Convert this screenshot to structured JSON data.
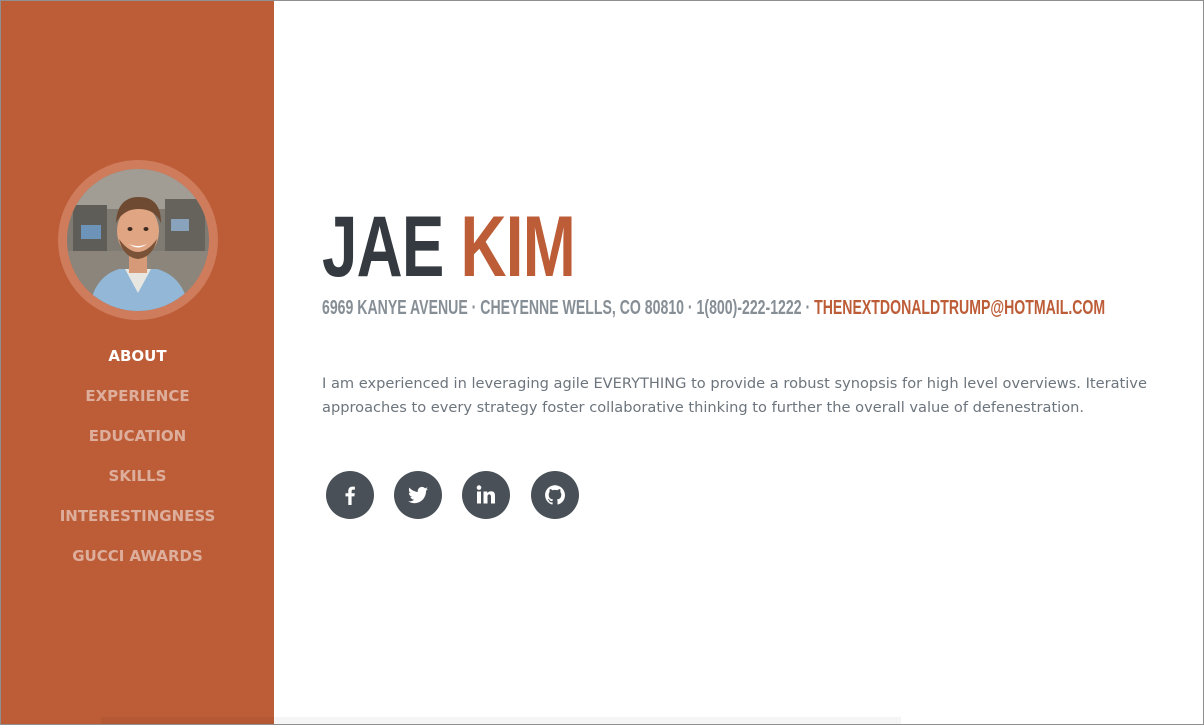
{
  "profile": {
    "first_name": "JAE",
    "last_name": "KIM",
    "address_line": "6969 Kanye Avenue · Cheyenne Wells, CO 80810 · 1(800)-222-1222 · ",
    "email": "thenextdonaldtrump@hotmail.com",
    "lead": "I am experienced in leveraging agile EVERYTHING to provide a robust synopsis for high level overviews. Iterative approaches to every strategy foster collaborative thinking to further the overall value of defenestration."
  },
  "nav": {
    "items": [
      {
        "label": "ABOUT"
      },
      {
        "label": "EXPERIENCE"
      },
      {
        "label": "EDUCATION"
      },
      {
        "label": "SKILLS"
      },
      {
        "label": "INTERESTINGNESS"
      },
      {
        "label": "GUCCI AWARDS"
      }
    ],
    "active": "ABOUT"
  },
  "social": {
    "icons": [
      "facebook-icon",
      "twitter-icon",
      "linkedin-icon",
      "github-icon"
    ]
  },
  "colors": {
    "accent": "#bd5d38",
    "dark": "#343a40",
    "muted": "#868e96",
    "social_bg": "#495057"
  }
}
